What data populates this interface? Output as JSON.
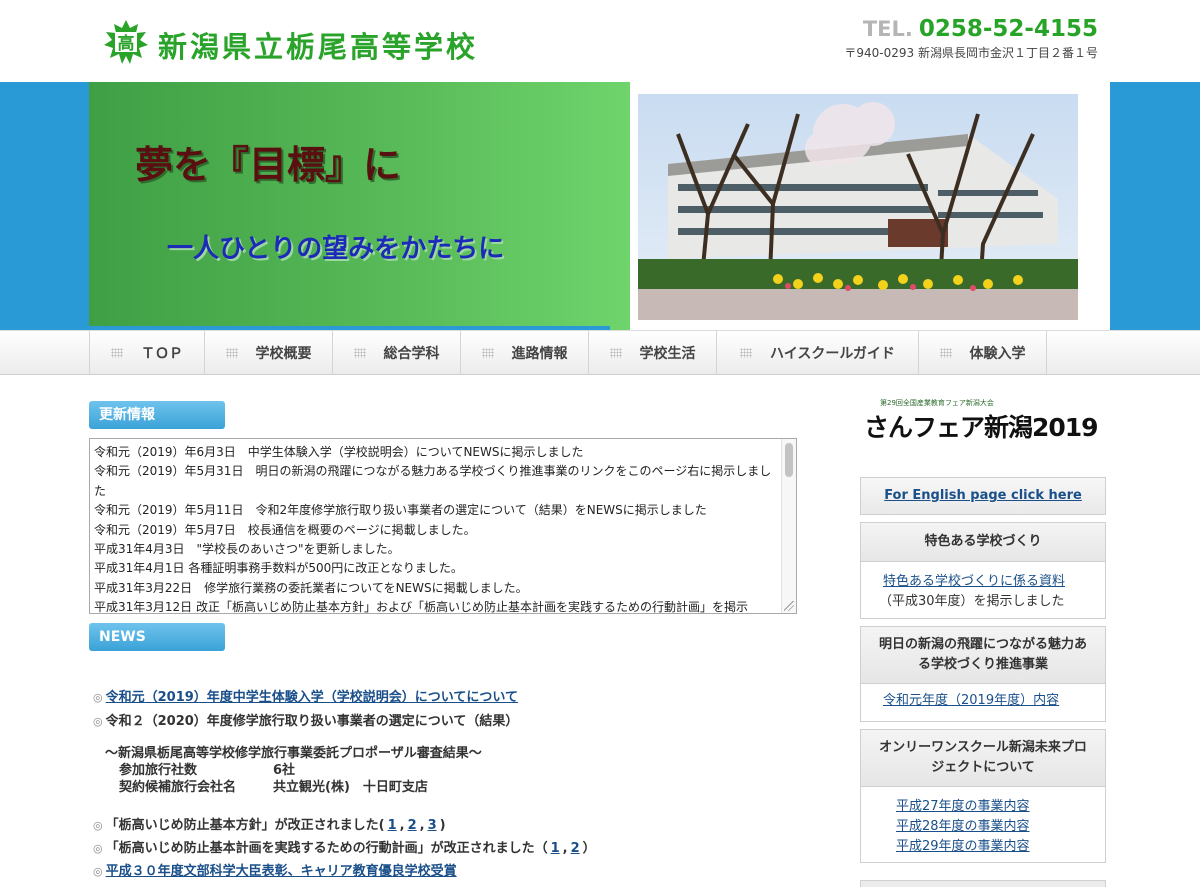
{
  "header": {
    "logo_char": "高",
    "school_name": "新潟県立栃尾高等学校",
    "tel_prefix": "TEL.",
    "tel_number": "0258-52-4155",
    "address": "〒940-0293 新潟県長岡市金沢１丁目２番１号"
  },
  "hero": {
    "slogan_main": "夢を『目標』に",
    "slogan_sub": "一人ひとりの望みをかたちに"
  },
  "nav": {
    "items": [
      {
        "label": "ＴＯＰ"
      },
      {
        "label": "学校概要"
      },
      {
        "label": "総合学科"
      },
      {
        "label": "進路情報"
      },
      {
        "label": "学校生活"
      },
      {
        "label": "ハイスクールガイド"
      },
      {
        "label": "体験入学"
      }
    ]
  },
  "updates": {
    "label": "更新情報",
    "lines": [
      "令和元（2019）年6月3日　中学生体験入学（学校説明会）についてNEWSに掲示しました",
      "令和元（2019）年5月31日　明日の新潟の飛躍につながる魅力ある学校づくり推進事業のリンクをこのページ右に掲示しました",
      "令和元（2019）年5月11日　令和2年度修学旅行取り扱い事業者の選定について（結果）をNEWSに掲示しました",
      "令和元（2019）年5月7日　校長通信を概要のページに掲載しました。",
      "平成31年4月3日　\"学校長のあいさつ\"を更新しました。",
      "平成31年4月1日 各種証明事務手数料が500円に改正となりました。",
      "平成31年3月22日　修学旅行業務の委託業者についてをNEWSに掲載しました。",
      "平成31年3月12日 改正「栃高いじめ防止基本方針」および「栃高いじめ防止基本計画を実践するための行動計画」を掲示"
    ]
  },
  "news": {
    "label": "NEWS",
    "bullet": "◎",
    "item1": "令和元（2019）年度中学生体験入学（学校説明会）についてについて",
    "item2": "令和２（2020）年度修学旅行取り扱い事業者の選定について（結果）",
    "sub_heading": "～新潟県栃尾高等学校修学旅行事業委託プロポーザル審査結果～",
    "sub_row1_label": "参加旅行社数",
    "sub_row1_value": "6社",
    "sub_row2_label": "契約候補旅行会社名",
    "sub_row2_value": "共立観光(株)　十日町支店",
    "item3_text": "「栃高いじめ防止基本方針」が改正されました(",
    "item3_links": [
      "1",
      "2",
      "3"
    ],
    "item3_close": ")",
    "item4_text": "「栃高いじめ防止基本計画を実践するための行動計画」が改正されました（",
    "item4_links": [
      "1",
      "2"
    ],
    "item4_close": "）",
    "item5": "平成３０年度文部科学大臣表彰、キャリア教育優良学校受賞",
    "sep": ","
  },
  "sidebar": {
    "sanfair_small": "第29回全国産業教育フェア新潟大会",
    "sanfair_text": "さんフェア新潟2019",
    "english_link": "For English page click here",
    "box1_title": "特色ある学校づくり",
    "box1_link": "特色ある学校づくりに係る資料",
    "box1_text": "（平成30年度）を掲示しました",
    "box2_title": "明日の新潟の飛躍につながる魅力ある学校づくり推進事業",
    "box2_link": "令和元年度（2019年度）内容",
    "box3_title": "オンリーワンスクール新潟未来プロジェクトについて",
    "box3_links": [
      "平成27年度の事業内容",
      "平成28年度の事業内容",
      "平成29年度の事業内容"
    ]
  },
  "colors": {
    "brand_green": "#2aa32a",
    "hero_blue": "#2a9ad6",
    "link_blue": "#1a4f8a",
    "label_blue": "#3aa2d8"
  }
}
